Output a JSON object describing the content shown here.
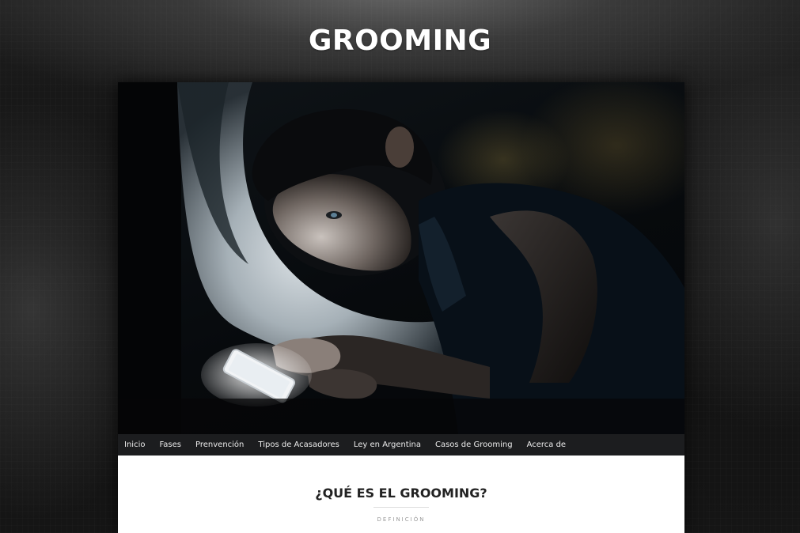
{
  "site": {
    "title": "GROOMING"
  },
  "hero": {
    "image_alt": "Niño acostado mirando un celular en la oscuridad"
  },
  "nav": {
    "items": [
      {
        "label": "Inicio"
      },
      {
        "label": "Fases"
      },
      {
        "label": "Prenvención"
      },
      {
        "label": "Tipos de Acasadores"
      },
      {
        "label": "Ley en Argentina"
      },
      {
        "label": "Casos de Grooming"
      },
      {
        "label": "Acerca de"
      }
    ]
  },
  "article": {
    "heading": "¿QUÉ ES EL GROOMING?",
    "subheading": "DEFINICIÓN"
  },
  "colors": {
    "nav_background": "#1c1d1f",
    "nav_text": "#ececec",
    "title_text": "#ffffff",
    "heading_text": "#222222",
    "subheading_text": "#9a9a9a"
  }
}
